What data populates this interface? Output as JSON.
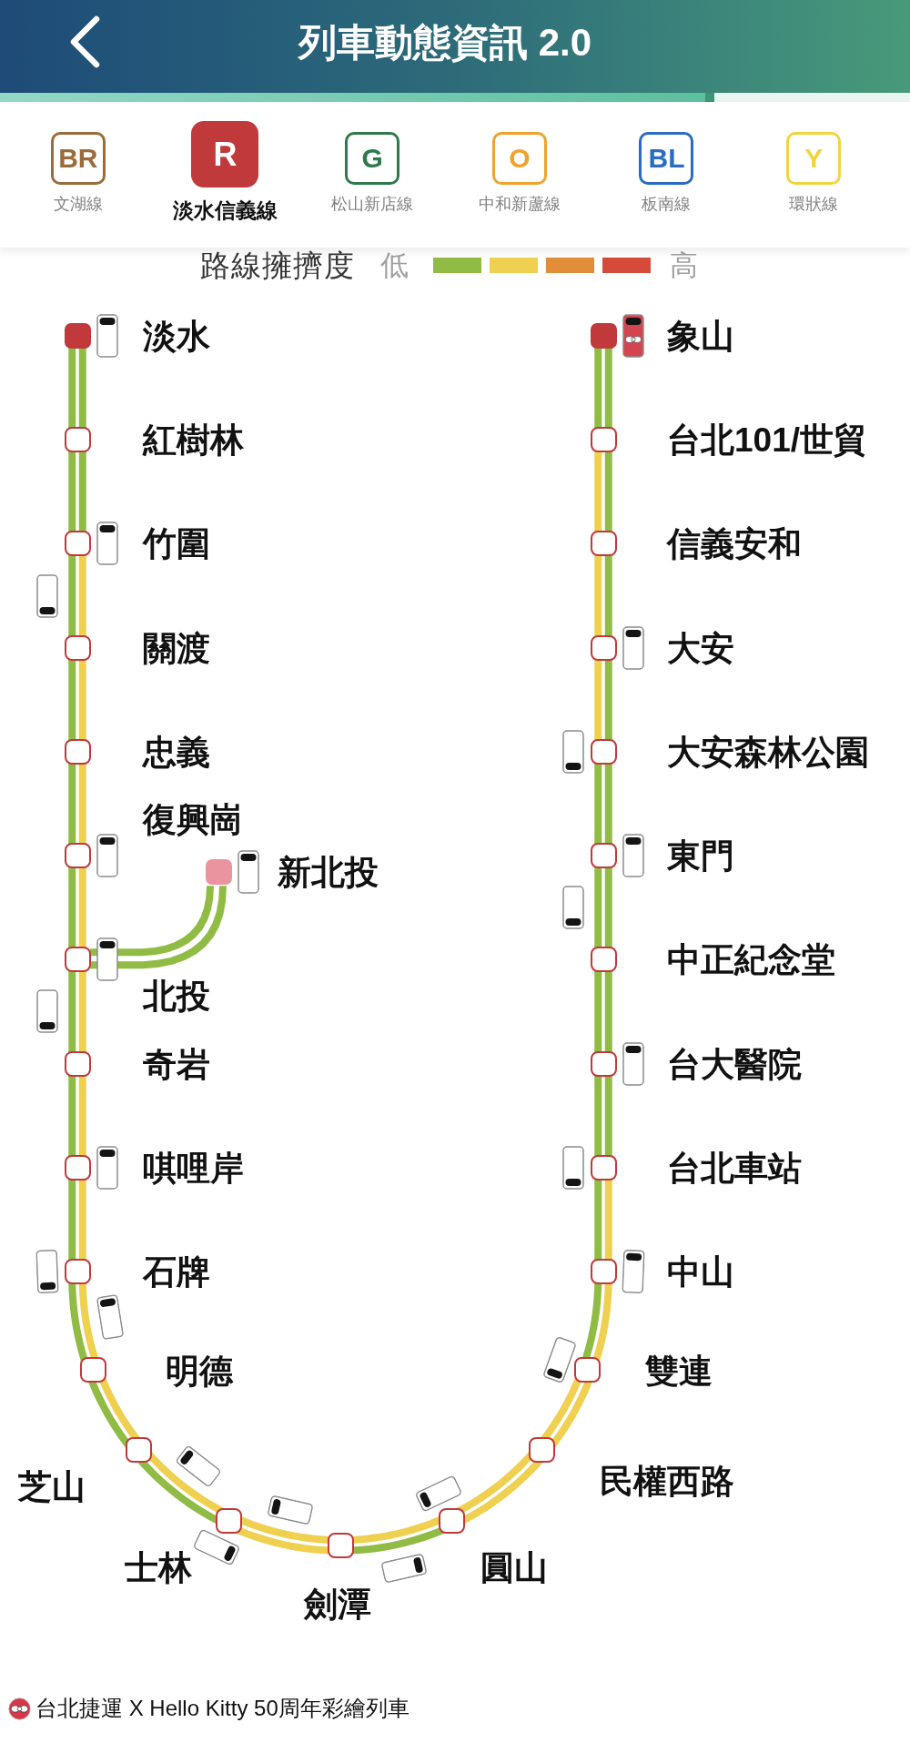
{
  "header": {
    "title": "列車動態資訊 2.0"
  },
  "refresh_progress": {
    "level": 0.785
  },
  "line_tabs": [
    {
      "code": "BR",
      "name": "文湖線",
      "color": "#9c6b3c",
      "selected": false
    },
    {
      "code": "R",
      "name": "淡水信義線",
      "color": "#c0393b",
      "selected": true
    },
    {
      "code": "G",
      "name": "松山新店線",
      "color": "#2e7a4c",
      "selected": false
    },
    {
      "code": "O",
      "name": "中和新蘆線",
      "color": "#f0a22e",
      "selected": false
    },
    {
      "code": "BL",
      "name": "板南線",
      "color": "#2a6cc2",
      "selected": false
    },
    {
      "code": "Y",
      "name": "環狀線",
      "color": "#f2d442",
      "selected": false
    }
  ],
  "crowding_legend": {
    "title": "路線擁擠度",
    "low_label": "低",
    "high_label": "高",
    "levels": [
      {
        "color": "#90bc45"
      },
      {
        "color": "#efd050"
      },
      {
        "color": "#e28e38"
      },
      {
        "color": "#d64a3a"
      }
    ]
  },
  "route": {
    "west_stations": [
      {
        "name": "淡水",
        "kind": "terminal",
        "trains_at_station": {
          "inner": [
            {
              "kind": "standard"
            }
          ]
        },
        "next_segment": {
          "outer": {
            "color": "#90bc45"
          },
          "inner": {
            "color": "#90bc45"
          }
        }
      },
      {
        "name": "紅樹林",
        "kind": "stop",
        "next_segment": {
          "outer": {
            "color": "#90bc45"
          },
          "inner": {
            "color": "#90bc45"
          }
        }
      },
      {
        "name": "竹圍",
        "kind": "stop",
        "trains_at_station": {
          "inner": [
            {
              "kind": "standard"
            }
          ]
        },
        "next_segment": {
          "outer": {
            "color": "#90bc45",
            "trains": [
              {
                "kind": "standard"
              }
            ]
          },
          "inner": {
            "color": "#efd050"
          }
        }
      },
      {
        "name": "關渡",
        "kind": "stop",
        "next_segment": {
          "outer": {
            "color": "#90bc45"
          },
          "inner": {
            "color": "#efd050"
          }
        }
      },
      {
        "name": "忠義",
        "kind": "stop",
        "next_segment": {
          "outer": {
            "color": "#90bc45"
          },
          "inner": {
            "color": "#efd050"
          }
        }
      },
      {
        "name": "復興崗",
        "kind": "stop",
        "trains_at_station": {
          "inner": [
            {
              "kind": "standard"
            }
          ]
        },
        "next_segment": {
          "outer": {
            "color": "#90bc45"
          },
          "inner": {
            "color": "#efd050"
          }
        }
      },
      {
        "name": "北投",
        "kind": "stop",
        "trains_at_station": {
          "inner": [
            {
              "kind": "standard"
            }
          ]
        },
        "branch": {
          "stations": [
            {
              "name": "新北投",
              "kind": "branch_terminal",
              "trains_at_station": {
                "outer": [
                  {
                    "kind": "standard"
                  }
                ]
              },
              "segment_to_trunk": {
                "outer": {
                  "color": "#90bc45"
                },
                "inner": {
                  "color": "#90bc45"
                }
              }
            }
          ]
        },
        "next_segment": {
          "outer": {
            "color": "#90bc45",
            "trains": [
              {
                "kind": "standard"
              }
            ]
          },
          "inner": {
            "color": "#efd050"
          }
        }
      },
      {
        "name": "奇岩",
        "kind": "stop",
        "next_segment": {
          "outer": {
            "color": "#90bc45"
          },
          "inner": {
            "color": "#efd050"
          }
        }
      },
      {
        "name": "唭哩岸",
        "kind": "stop",
        "trains_at_station": {
          "inner": [
            {
              "kind": "standard"
            }
          ]
        },
        "next_segment": {
          "outer": {
            "color": "#90bc45"
          },
          "inner": {
            "color": "#efd050"
          }
        }
      },
      {
        "name": "石牌",
        "kind": "stop",
        "trains_at_station": {
          "outer": [
            {
              "kind": "standard"
            }
          ]
        },
        "next_segment": {
          "outer": {
            "color": "#90bc45"
          },
          "inner": {
            "color": "#efd050",
            "trains": [
              {
                "kind": "standard"
              }
            ]
          }
        }
      },
      {
        "name": "明德",
        "kind": "stop",
        "next_segment": {
          "outer": {
            "color": "#90bc45"
          },
          "inner": {
            "color": "#efd050"
          }
        }
      },
      {
        "name": "芝山",
        "kind": "stop",
        "next_segment": {
          "outer": {
            "color": "#90bc45"
          },
          "inner": {
            "color": "#efd050",
            "trains": [
              {
                "kind": "standard"
              }
            ]
          }
        }
      },
      {
        "name": "士林",
        "kind": "stop",
        "trains_at_station": {
          "outer": [
            {
              "kind": "standard"
            }
          ]
        },
        "next_segment": {
          "outer": {
            "color": "#efd050"
          },
          "inner": {
            "color": "#efd050",
            "trains": [
              {
                "kind": "standard"
              }
            ]
          }
        }
      },
      {
        "name": "劍潭",
        "kind": "stop",
        "next_segment": {
          "outer": {
            "color": "#90bc45",
            "trains": [
              {
                "kind": "standard"
              }
            ]
          },
          "inner": {
            "color": "#efd050"
          }
        }
      }
    ],
    "east_stations": [
      {
        "name": "象山",
        "kind": "terminal",
        "trains_at_station": {
          "outer": [
            {
              "kind": "special_livery"
            }
          ]
        },
        "next_segment": {
          "outer": {
            "color": "#90bc45"
          },
          "inner": {
            "color": "#90bc45"
          }
        }
      },
      {
        "name": "台北101/世貿",
        "kind": "stop",
        "next_segment": {
          "outer": {
            "color": "#90bc45"
          },
          "inner": {
            "color": "#efd050"
          }
        }
      },
      {
        "name": "信義安和",
        "kind": "stop",
        "next_segment": {
          "outer": {
            "color": "#90bc45"
          },
          "inner": {
            "color": "#efd050"
          }
        }
      },
      {
        "name": "大安",
        "kind": "stop",
        "trains_at_station": {
          "outer": [
            {
              "kind": "standard"
            }
          ]
        },
        "next_segment": {
          "outer": {
            "color": "#90bc45"
          },
          "inner": {
            "color": "#efd050"
          }
        }
      },
      {
        "name": "大安森林公園",
        "kind": "stop",
        "trains_at_station": {
          "inner": [
            {
              "kind": "standard"
            }
          ]
        },
        "next_segment": {
          "outer": {
            "color": "#90bc45"
          },
          "inner": {
            "color": "#90bc45"
          }
        }
      },
      {
        "name": "東門",
        "kind": "stop",
        "trains_at_station": {
          "outer": [
            {
              "kind": "standard"
            }
          ]
        },
        "next_segment": {
          "outer": {
            "color": "#90bc45"
          },
          "inner": {
            "color": "#90bc45",
            "trains": [
              {
                "kind": "standard"
              }
            ]
          }
        }
      },
      {
        "name": "中正紀念堂",
        "kind": "stop",
        "next_segment": {
          "outer": {
            "color": "#90bc45"
          },
          "inner": {
            "color": "#90bc45"
          }
        }
      },
      {
        "name": "台大醫院",
        "kind": "stop",
        "trains_at_station": {
          "outer": [
            {
              "kind": "standard"
            }
          ]
        },
        "next_segment": {
          "outer": {
            "color": "#90bc45"
          },
          "inner": {
            "color": "#90bc45"
          }
        }
      },
      {
        "name": "台北車站",
        "kind": "stop",
        "trains_at_station": {
          "inner": [
            {
              "kind": "standard"
            }
          ]
        },
        "next_segment": {
          "outer": {
            "color": "#efd050"
          },
          "inner": {
            "color": "#90bc45"
          }
        }
      },
      {
        "name": "中山",
        "kind": "stop",
        "trains_at_station": {
          "outer": [
            {
              "kind": "standard"
            }
          ]
        },
        "next_segment": {
          "outer": {
            "color": "#efd050"
          },
          "inner": {
            "color": "#90bc45"
          }
        }
      },
      {
        "name": "雙連",
        "kind": "stop",
        "trains_at_station": {
          "inner": [
            {
              "kind": "standard"
            }
          ]
        },
        "next_segment": {
          "outer": {
            "color": "#efd050"
          },
          "inner": {
            "color": "#efd050"
          }
        }
      },
      {
        "name": "民權西路",
        "kind": "stop",
        "next_segment": {
          "outer": {
            "color": "#efd050"
          },
          "inner": {
            "color": "#efd050"
          }
        }
      },
      {
        "name": "圓山",
        "kind": "stop",
        "trains_at_station": {
          "inner": [
            {
              "kind": "standard"
            }
          ]
        }
      }
    ]
  },
  "footer": {
    "note": "台北捷運 X Hello Kitty 50周年彩繪列車"
  }
}
